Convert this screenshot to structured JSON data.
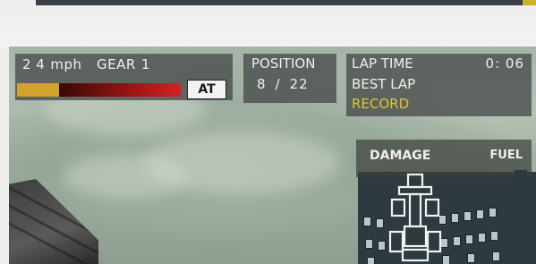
{
  "hud": {
    "speed": "2 4",
    "speed_unit": "mph",
    "gear_label": "GEAR",
    "gear_value": "1",
    "rev_level": 0.27,
    "transmission": "AT",
    "position_label": "POSITION",
    "position_current": "8",
    "position_separator": "/",
    "position_total": "22",
    "lap_time_label": "LAP  TIME",
    "lap_time_value": "0: 06",
    "best_lap_label": "BEST  LAP",
    "record_label": "RECORD",
    "damage_label": "DAMAGE",
    "fuel_label": "FUEL"
  },
  "colors": {
    "rev_low": "#d2a22b",
    "rev_high": "#d22222",
    "record_text": "#e4c232",
    "hud_panel": "#464b4a"
  },
  "icons": [
    "car-damage-icon"
  ]
}
